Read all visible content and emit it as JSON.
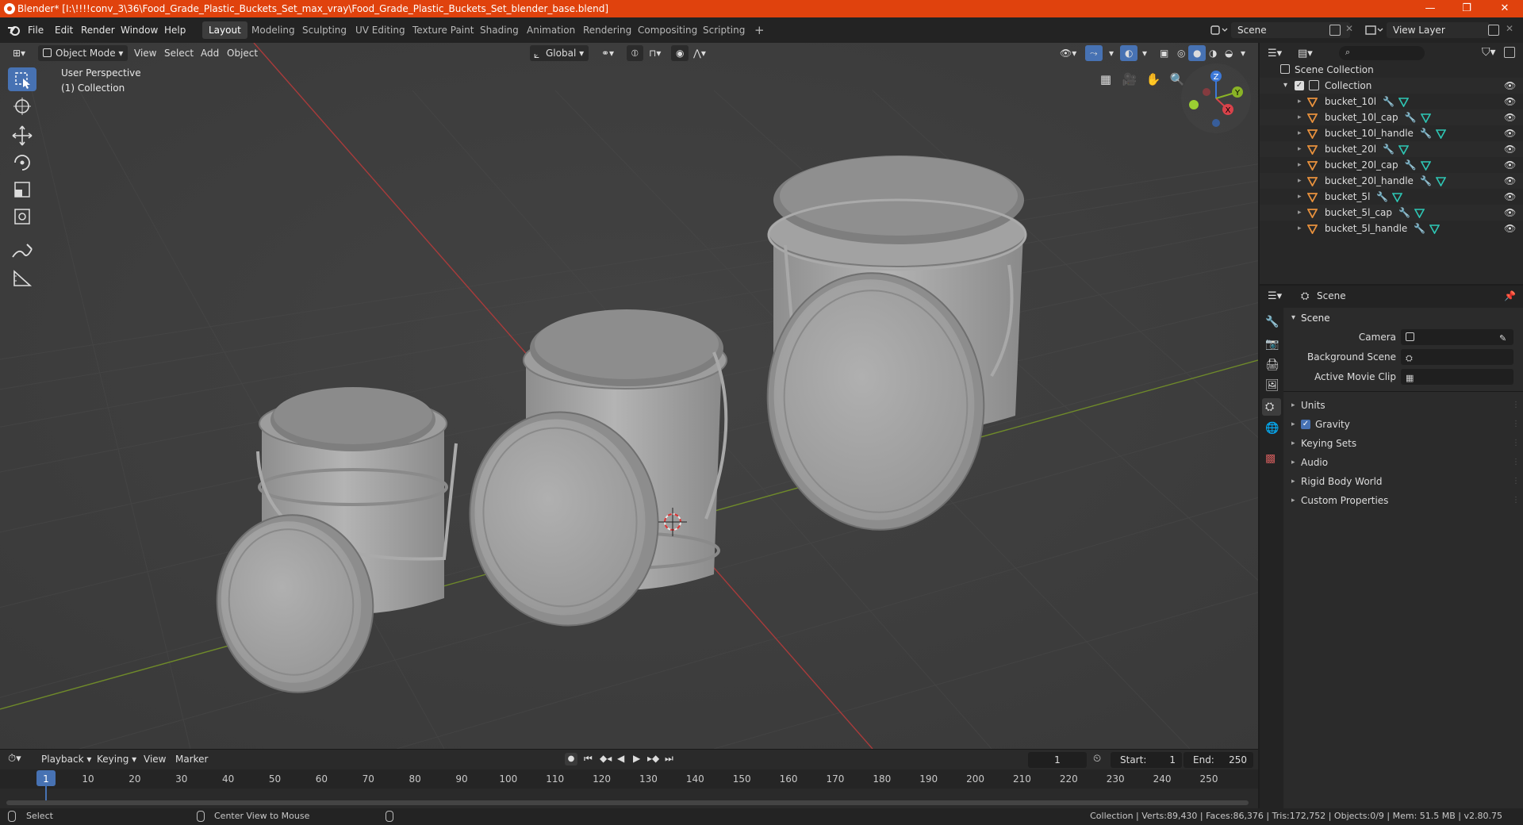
{
  "titlebar": {
    "title": "Blender* [I:\\!!!!conv_3\\36\\Food_Grade_Plastic_Buckets_Set_max_vray\\Food_Grade_Plastic_Buckets_Set_blender_base.blend]",
    "minimize": "—",
    "maximize": "❐",
    "close": "✕"
  },
  "menu": [
    "File",
    "Edit",
    "Render",
    "Window",
    "Help"
  ],
  "workspaces": [
    "Layout",
    "Modeling",
    "Sculpting",
    "UV Editing",
    "Texture Paint",
    "Shading",
    "Animation",
    "Rendering",
    "Compositing",
    "Scripting",
    "+"
  ],
  "scene_field": "Scene",
  "viewlayer_field": "View Layer",
  "viewport": {
    "mode": "Object Mode",
    "menus": [
      "View",
      "Select",
      "Add",
      "Object"
    ],
    "transform": "Global",
    "overlay_title": "User Perspective",
    "overlay_collection": "(1) Collection",
    "gizmo_axes": {
      "x": "X",
      "y": "Y",
      "z": "Z"
    }
  },
  "outliner": {
    "root": "Scene Collection",
    "collection": "Collection",
    "items": [
      "bucket_10l",
      "bucket_10l_cap",
      "bucket_10l_handle",
      "bucket_20l",
      "bucket_20l_cap",
      "bucket_20l_handle",
      "bucket_5l",
      "bucket_5l_cap",
      "bucket_5l_handle"
    ]
  },
  "properties": {
    "context": "Scene",
    "panel": "Scene",
    "camera_label": "Camera",
    "background_label": "Background Scene",
    "movieclip_label": "Active Movie Clip",
    "sections": [
      "Units",
      "Gravity",
      "Keying Sets",
      "Audio",
      "Rigid Body World",
      "Custom Properties"
    ]
  },
  "timeline": {
    "menus": [
      "Playback",
      "Keying",
      "View",
      "Marker"
    ],
    "current_frame": "1",
    "start_label": "Start:",
    "start": "1",
    "end_label": "End:",
    "end": "250",
    "ticks": [
      "1",
      "10",
      "20",
      "30",
      "40",
      "50",
      "60",
      "70",
      "80",
      "90",
      "100",
      "110",
      "120",
      "130",
      "140",
      "150",
      "160",
      "170",
      "180",
      "190",
      "200",
      "210",
      "220",
      "230",
      "240",
      "250"
    ]
  },
  "statusbar": {
    "select": "Select",
    "center": "Center View to Mouse",
    "stats": "Collection | Verts:89,430 | Faces:86,376 | Tris:172,752 | Objects:0/9 | Mem: 51.5 MB | v2.80.75"
  },
  "colors": {
    "title_bar": "#e0420d",
    "active_tool": "#4772b3",
    "x_axis": "#d9424a",
    "y_axis": "#8ab326",
    "z_axis": "#3c78d8",
    "mesh_icon": "#e8913d",
    "modifier_icon": "#5aa0e8",
    "data_icon": "#2ec7b5"
  }
}
